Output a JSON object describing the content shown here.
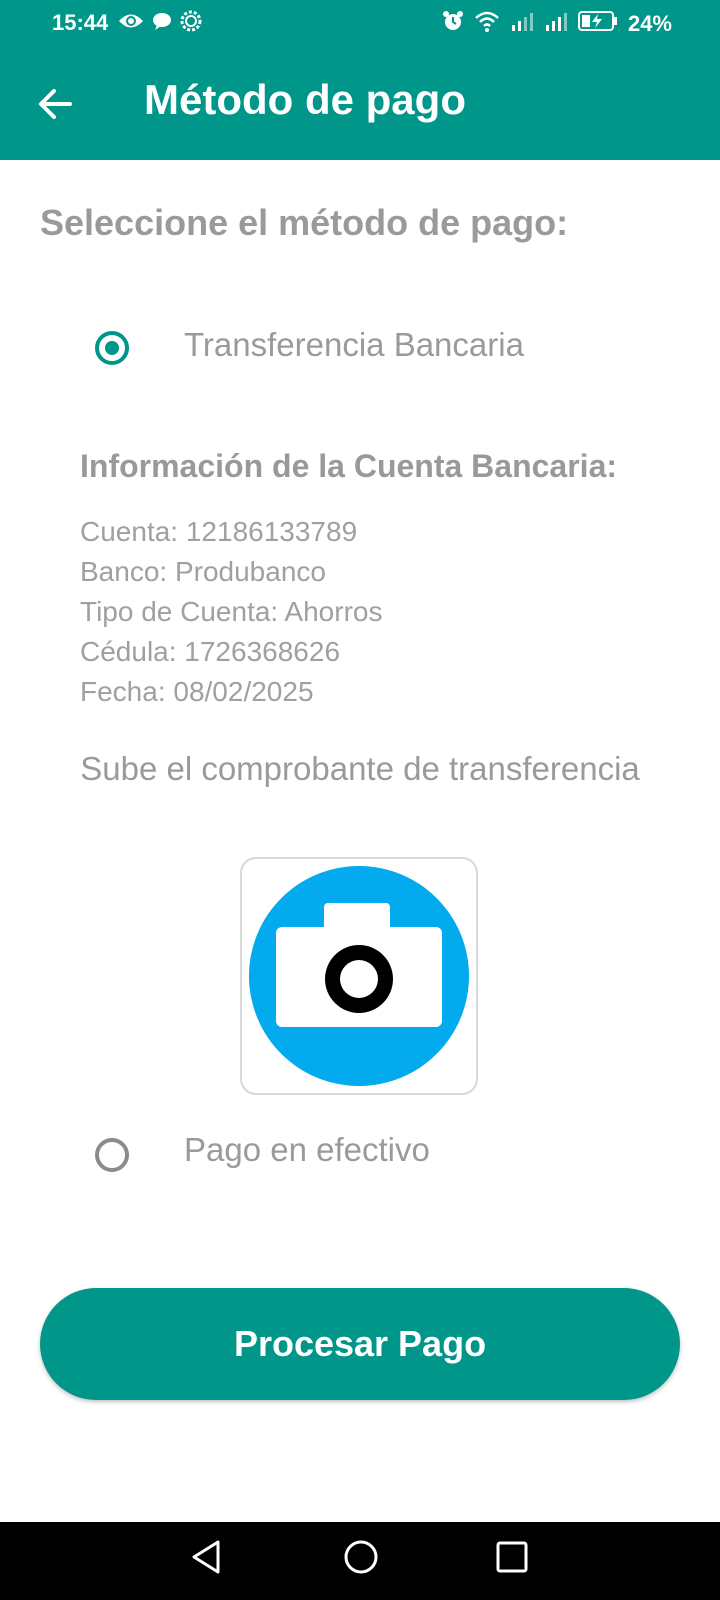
{
  "status_bar": {
    "time": "15:44",
    "battery_percent": "24%",
    "background_color": "#00968a",
    "left_icons": [
      "eye-icon",
      "chat-bubble-icon",
      "settings-gear-icon"
    ],
    "right_icons": [
      "alarm-icon",
      "wifi-icon",
      "signal-1-icon",
      "signal-2-icon",
      "battery-charging-icon"
    ]
  },
  "app_bar": {
    "title": "Método de pago",
    "back_icon": "arrow-left-icon",
    "background_color": "#00968a"
  },
  "main": {
    "section_title": "Seleccione el método de pago:",
    "options": [
      {
        "label": "Transferencia Bancaria",
        "selected": true
      },
      {
        "label": "Pago en efectivo",
        "selected": false
      }
    ],
    "bank_info": {
      "heading": "Información de la Cuenta Bancaria:",
      "lines": [
        "Cuenta: 12186133789",
        "Banco: Produbanco",
        "Tipo de Cuenta: Ahorros",
        "Cédula: 1726368626",
        "Fecha: 08/02/2025"
      ]
    },
    "upload": {
      "label": "Sube el comprobante de transferencia",
      "icon": "camera-icon",
      "icon_color": "#03aaee"
    },
    "process_button_label": "Procesar Pago",
    "accent_color": "#00968a"
  },
  "nav_bar": {
    "buttons": [
      "back-triangle-icon",
      "home-circle-icon",
      "recents-square-icon"
    ]
  }
}
